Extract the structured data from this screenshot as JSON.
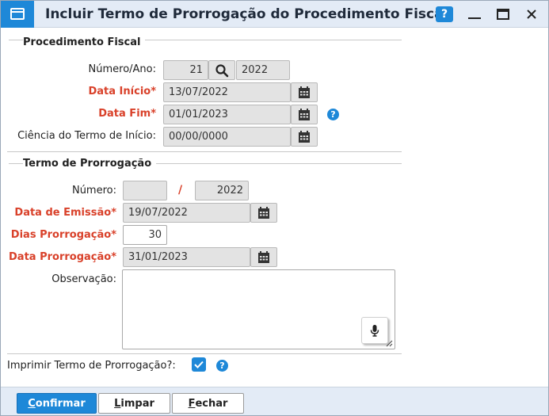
{
  "window": {
    "title": "Incluir Termo de Prorrogação do Procedimento Fiscal",
    "help_label": "?"
  },
  "procedimento": {
    "group_title": "Procedimento Fiscal",
    "numero_ano_label": "Número/Ano:",
    "numero_value": "21",
    "ano_value": "2022",
    "data_inicio_label": "Data Início*",
    "data_inicio_value": "13/07/2022",
    "data_fim_label": "Data Fim*",
    "data_fim_value": "01/01/2023",
    "ciencia_label": "Ciência do Termo de Início:",
    "ciencia_value": "00/00/0000"
  },
  "prorrogacao": {
    "group_title": "Termo de Prorrogação",
    "numero_label": "Número:",
    "numero_value": "",
    "separator": "/",
    "ano_value": "2022",
    "data_emissao_label": "Data de Emissão*",
    "data_emissao_value": "19/07/2022",
    "dias_label": "Dias Prorrogação*",
    "dias_value": "30",
    "data_prorrogacao_label": "Data Prorrogação*",
    "data_prorrogacao_value": "31/01/2023",
    "observacao_label": "Observação:",
    "observacao_value": ""
  },
  "imprimir": {
    "label": "Imprimir Termo de Prorrogação?:",
    "checked": true
  },
  "buttons": {
    "confirmar": {
      "first": "C",
      "rest": "onfirmar"
    },
    "limpar": {
      "first": "L",
      "rest": "impar"
    },
    "fechar": {
      "first": "F",
      "rest": "echar"
    }
  },
  "colors": {
    "accent": "#1e88d8",
    "required": "#d9412a",
    "titlebar": "#e3ebf6",
    "readonly_field": "#e3e3e3"
  },
  "icons": {
    "app": "window-icon",
    "search": "magnifier-icon",
    "calendar": "calendar-icon",
    "help": "question-icon",
    "mic": "microphone-icon",
    "check": "checkmark-icon"
  }
}
